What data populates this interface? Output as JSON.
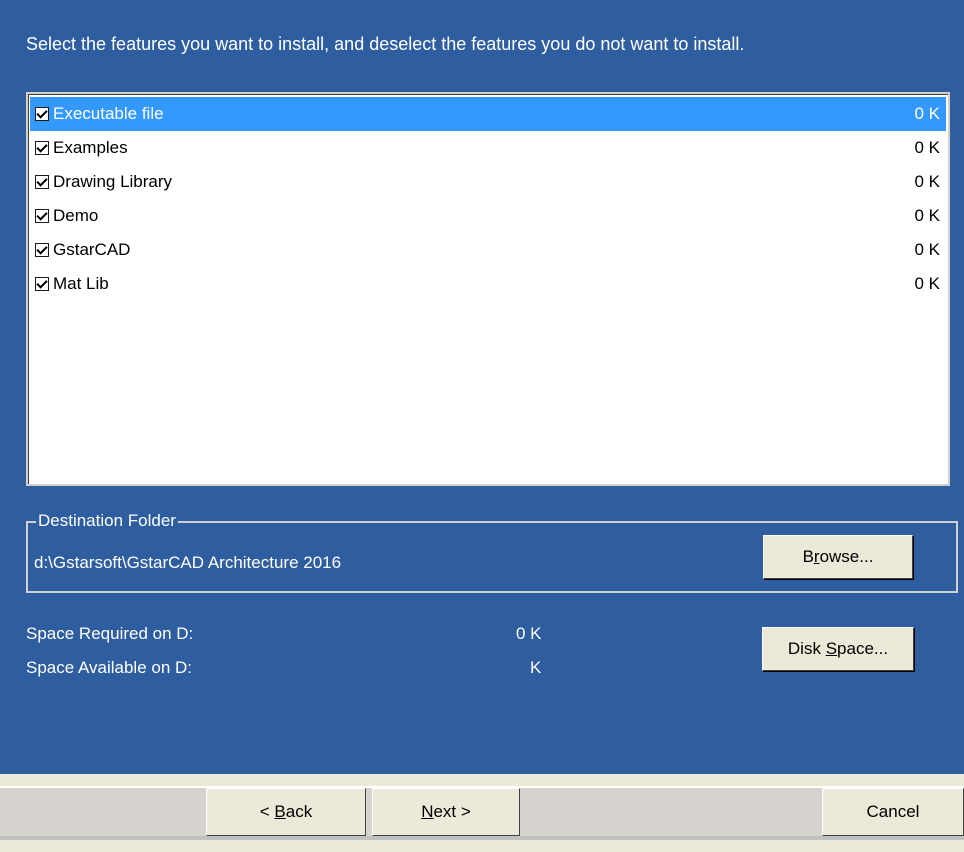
{
  "instruction": "Select the features you want to install, and deselect the features you do not want to install.",
  "features": [
    {
      "label": "Executable file",
      "size": "0 K",
      "checked": true,
      "selected": true
    },
    {
      "label": "Examples",
      "size": "0 K",
      "checked": true,
      "selected": false
    },
    {
      "label": "Drawing Library",
      "size": "0 K",
      "checked": true,
      "selected": false
    },
    {
      "label": "Demo",
      "size": "0 K",
      "checked": true,
      "selected": false
    },
    {
      "label": "GstarCAD",
      "size": "0 K",
      "checked": true,
      "selected": false
    },
    {
      "label": "Mat Lib",
      "size": "0 K",
      "checked": true,
      "selected": false
    }
  ],
  "destination": {
    "legend": "Destination Folder",
    "path": "d:\\Gstarsoft\\GstarCAD Architecture 2016",
    "browse_label_pre": "B",
    "browse_label_accel": "r",
    "browse_label_post": "owse..."
  },
  "space": {
    "required_label": "Space Required on D:",
    "required_value": "0 K",
    "available_label": "Space Available on D:",
    "available_value": "K",
    "disk_label_pre": "Disk ",
    "disk_label_accel": "S",
    "disk_label_post": "pace..."
  },
  "nav": {
    "back_pre": "< ",
    "back_accel": "B",
    "back_post": "ack",
    "next_accel": "N",
    "next_post": "ext >",
    "cancel": "Cancel"
  },
  "colors": {
    "panel_bg": "#2e5ea0",
    "selection": "#3399ff"
  }
}
